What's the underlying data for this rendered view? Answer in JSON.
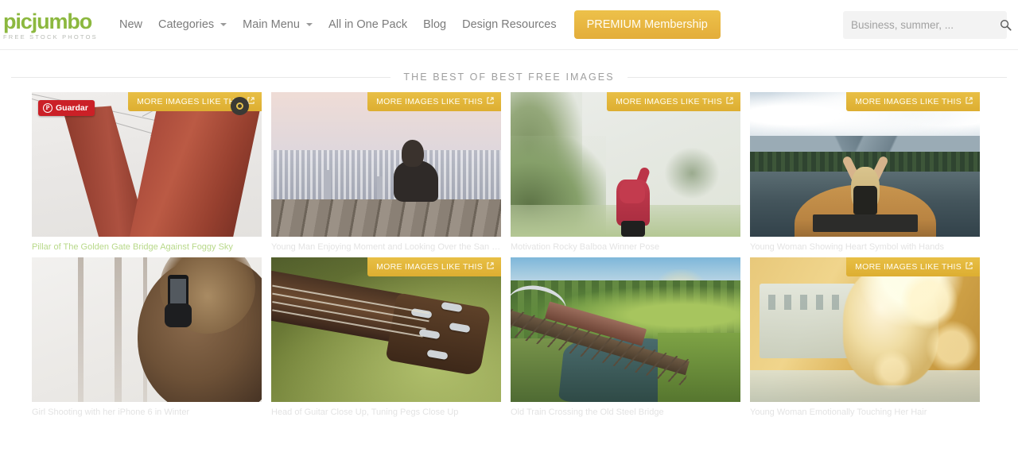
{
  "header": {
    "logo": {
      "name": "picjumbo",
      "tagline": "FREE STOCK PHOTOS"
    },
    "nav": [
      {
        "label": "New",
        "has_caret": false
      },
      {
        "label": "Categories",
        "has_caret": true
      },
      {
        "label": "Main Menu",
        "has_caret": true
      },
      {
        "label": "All in One Pack",
        "has_caret": false
      },
      {
        "label": "Blog",
        "has_caret": false
      },
      {
        "label": "Design Resources",
        "has_caret": false
      }
    ],
    "premium_label": "PREMIUM Membership",
    "search": {
      "placeholder": "Business, summer, ...",
      "value": "",
      "icon": "search-icon"
    }
  },
  "section": {
    "title": "THE BEST OF BEST FREE IMAGES"
  },
  "ribbon": {
    "label": "MORE IMAGES LIKE THIS",
    "icon": "external-link-icon"
  },
  "pinterest": {
    "label": "Guardar",
    "icon": "pinterest-icon"
  },
  "colors": {
    "brand_green": "#8cb83f",
    "gold": "#e3ad3a",
    "pinterest_red": "#cb2027",
    "caption_gray": "#e3e3e3",
    "caption_active": "#b8d98a"
  },
  "gallery": {
    "rows": [
      {
        "cards": [
          {
            "caption": "Pillar of The Golden Gate Bridge Against Foggy Sky",
            "scene": "gg",
            "active": true,
            "ribbon": true,
            "pin": true,
            "share": true
          },
          {
            "caption": "Young Man Enjoying Moment and Looking Over the San Francisco",
            "scene": "sf",
            "active": false,
            "ribbon": true,
            "pin": false,
            "share": false
          },
          {
            "caption": "Motivation Rocky Balboa Winner Pose",
            "scene": "fog",
            "active": false,
            "ribbon": true,
            "pin": false,
            "share": false
          },
          {
            "caption": "Young Woman Showing Heart Symbol with Hands",
            "scene": "lk",
            "active": false,
            "ribbon": true,
            "pin": false,
            "share": false
          }
        ]
      },
      {
        "cards": [
          {
            "caption": "Girl Shooting with her iPhone 6 in Winter",
            "scene": "wn",
            "active": false,
            "ribbon": false,
            "pin": false,
            "share": false
          },
          {
            "caption": "Head of Guitar Close Up, Tuning Pegs Close Up",
            "scene": "gt",
            "active": false,
            "ribbon": true,
            "pin": false,
            "share": false
          },
          {
            "caption": "Old Train Crossing the Old Steel Bridge",
            "scene": "tb",
            "active": false,
            "ribbon": false,
            "pin": false,
            "share": false
          },
          {
            "caption": "Young Woman Emotionally Touching Her Hair",
            "scene": "gh",
            "active": false,
            "ribbon": true,
            "pin": false,
            "share": false
          }
        ]
      }
    ]
  }
}
